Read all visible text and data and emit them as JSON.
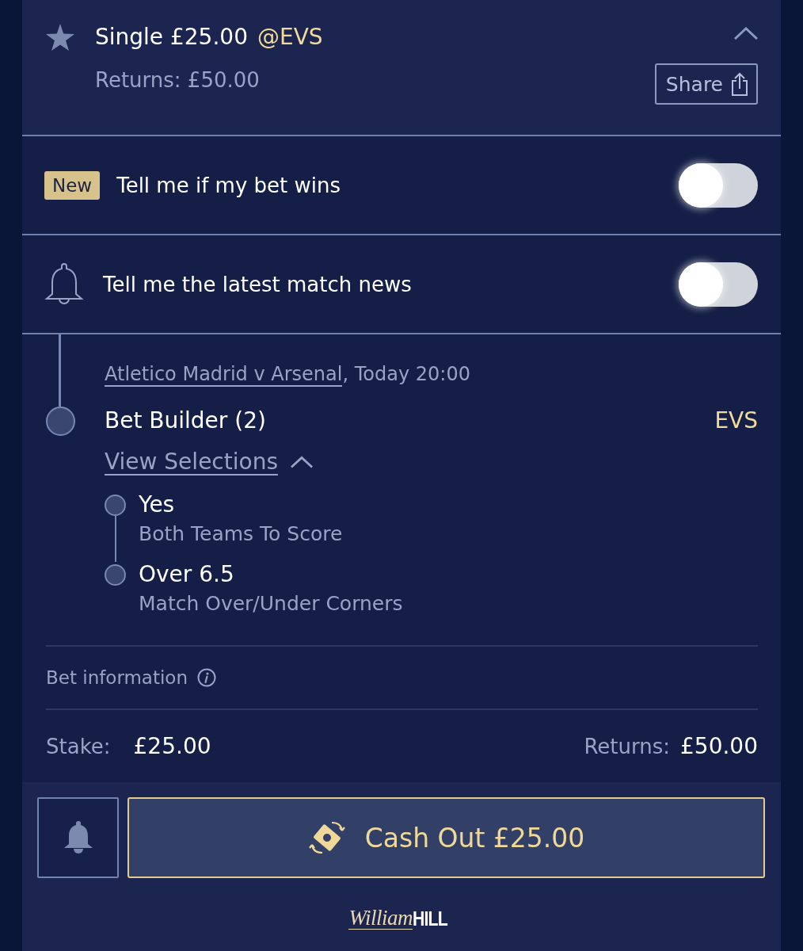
{
  "bet": {
    "title": "Single £25.00",
    "odds": "@EVS",
    "returns": "Returns: £50.00",
    "expanded": true,
    "share_button": "Share"
  },
  "notifications": [
    {
      "kind": "badge",
      "badge": "New",
      "label": "Tell me if my bet wins",
      "on": false
    },
    {
      "kind": "bell",
      "label": "Tell me the latest match news",
      "on": false
    }
  ],
  "selection": {
    "event": "Atletico Madrid v Arsenal",
    "event_time": ", Today 20:00",
    "market": "Bet Builder (2)",
    "odds": "EVS",
    "view_selections": "View Selections",
    "expanded": true,
    "legs": [
      {
        "name": "Yes",
        "market": "Both Teams To Score"
      },
      {
        "name": "Over 6.5",
        "market": "Match Over/Under Corners"
      }
    ]
  },
  "bet_information": "Bet information",
  "stake": {
    "label": "Stake:",
    "value": "£25.00"
  },
  "returns": {
    "label": "Returns:",
    "value": "£50.00"
  },
  "cash_out": "Cash Out £25.00",
  "logo": {
    "script": "William",
    "bold": "HILL"
  }
}
